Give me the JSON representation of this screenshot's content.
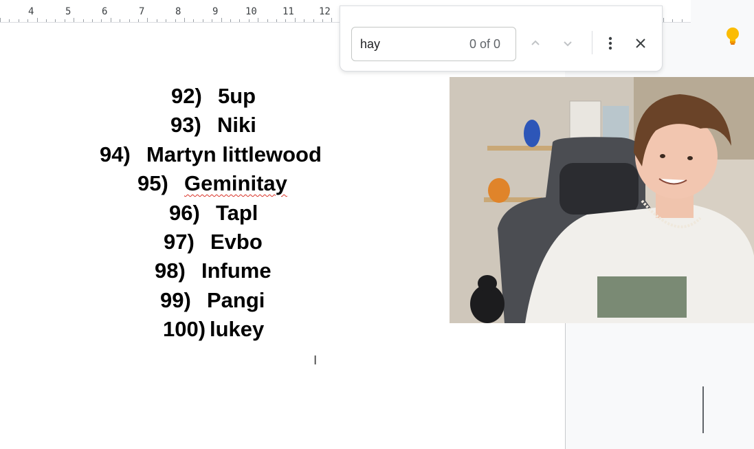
{
  "ruler": {
    "numbers": [
      "4",
      "5",
      "6",
      "7",
      "8",
      "9",
      "10",
      "11",
      "12"
    ]
  },
  "find": {
    "query": "hay",
    "count": "0 of 0",
    "prev_icon": "chevron-up-icon",
    "next_icon": "chevron-down-icon",
    "more_icon": "more-vert-icon",
    "close_icon": "close-icon"
  },
  "document": {
    "items": [
      {
        "num": "92)",
        "name": "5up"
      },
      {
        "num": "93)",
        "name": "Niki"
      },
      {
        "num": "94)",
        "name": "Martyn littlewood"
      },
      {
        "num": "95)",
        "name": "Geminitay"
      },
      {
        "num": "96)",
        "name": "Tapl"
      },
      {
        "num": "97)",
        "name": "Evbo"
      },
      {
        "num": "98)",
        "name": "Infume"
      },
      {
        "num": "99)",
        "name": "Pangi"
      },
      {
        "num": "100)",
        "name": "lukey"
      }
    ]
  },
  "cursor_glyph": "I",
  "colors": {
    "bulb": "#f9ab00",
    "spellcheck": "#d93025",
    "panel": "#f8f9fa"
  }
}
